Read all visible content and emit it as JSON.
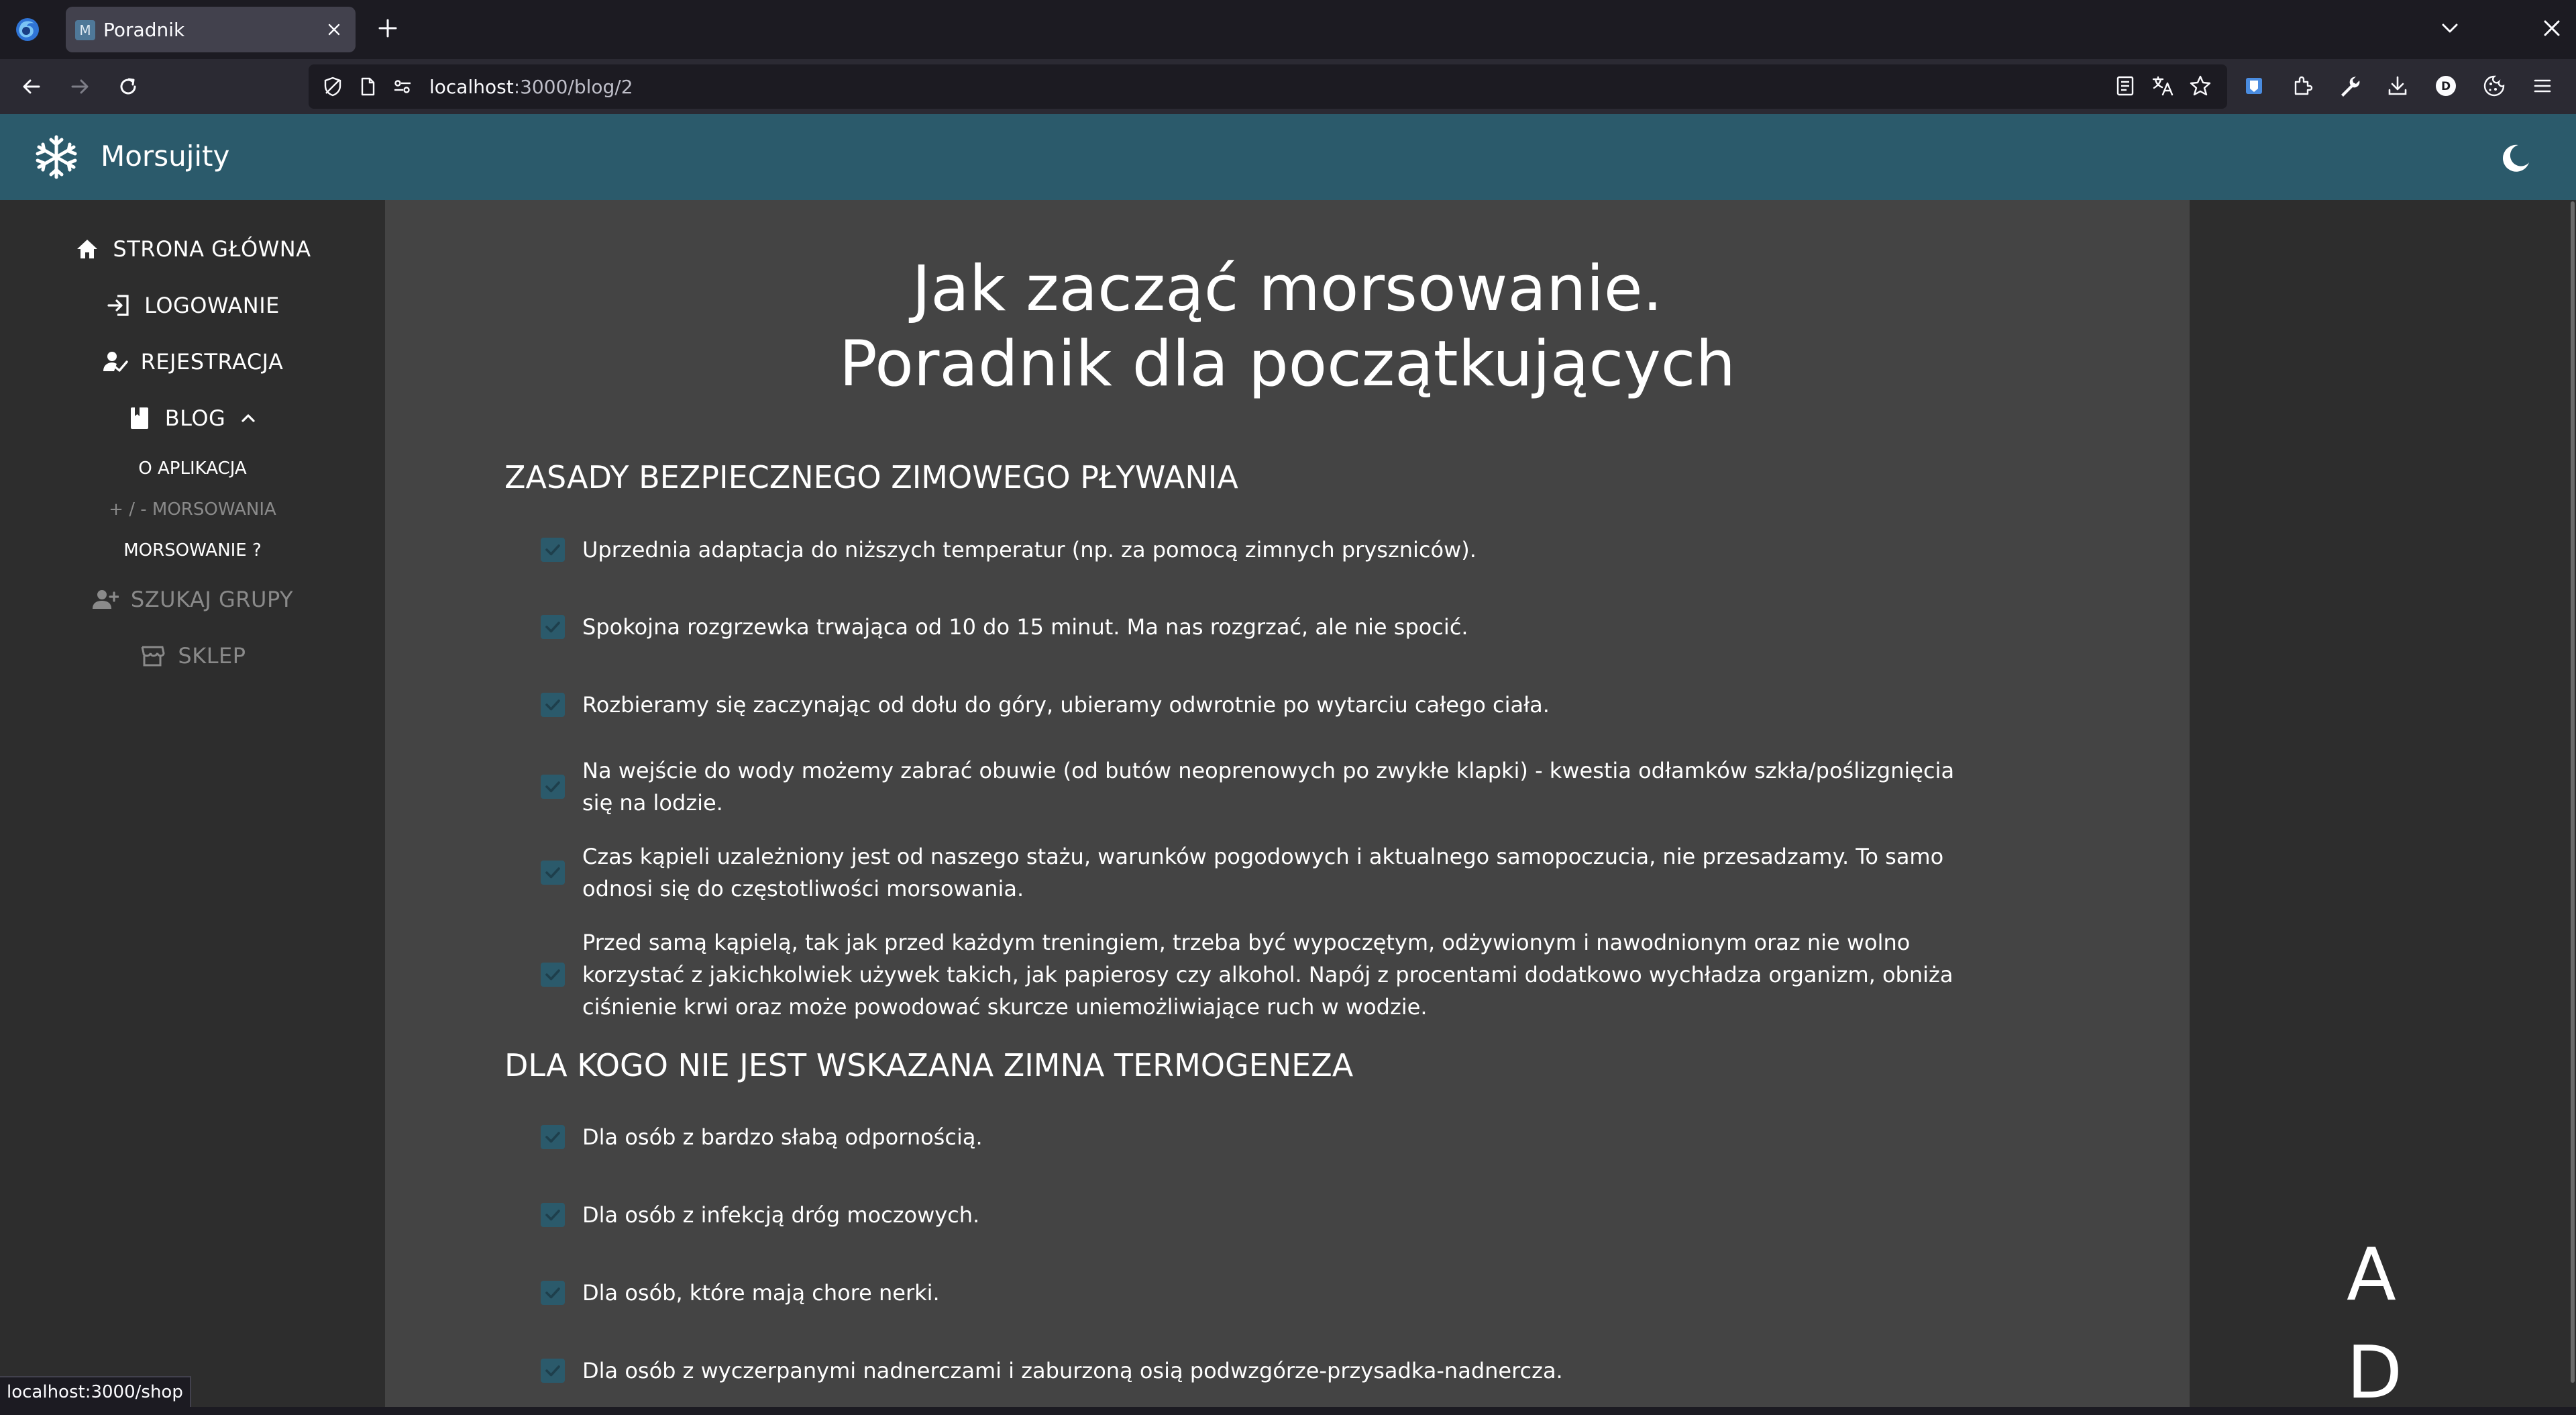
{
  "browser": {
    "tab": {
      "favicon_letter": "M",
      "title": "Poradnik"
    },
    "url": {
      "host": "localhost",
      "path": ":3000/blog/2"
    },
    "status_url": "localhost:3000/shop"
  },
  "app": {
    "title": "Morsujity",
    "brand_color": "#2b5a6b"
  },
  "sidebar": {
    "items": [
      {
        "label": "STRONA GŁÓWNA",
        "icon": "home-icon"
      },
      {
        "label": "LOGOWANIE",
        "icon": "login-icon"
      },
      {
        "label": "REJESTRACJA",
        "icon": "register-icon"
      },
      {
        "label": "BLOG",
        "icon": "book-icon",
        "expanded": true
      },
      {
        "label": "SZUKAJ GRUPY",
        "icon": "group-add-icon",
        "disabled": true
      },
      {
        "label": "SKLEP",
        "icon": "store-icon",
        "disabled": true
      }
    ],
    "blog_sub": [
      {
        "label": "O APLIKACJA",
        "active": false
      },
      {
        "label": "+ / - MORSOWANIA",
        "active": false,
        "dimmed": true
      },
      {
        "label": "MORSOWANIE ?",
        "active": true
      }
    ]
  },
  "article": {
    "title_line1": "Jak zacząć morsowanie.",
    "title_line2": "Poradnik dla początkujących",
    "sections": [
      {
        "heading": "ZASADY BEZPIECZNEGO ZIMOWEGO PŁYWANIA",
        "items": [
          "Uprzednia adaptacja do niższych temperatur (np. za pomocą zimnych pryszniców).",
          "Spokojna rozgrzewka trwająca od 10 do 15 minut. Ma nas rozgrzać, ale nie spocić.",
          "Rozbieramy się zaczynając od dołu do góry, ubieramy odwrotnie po wytarciu całego ciała.",
          "Na wejście do wody możemy zabrać obuwie (od butów neoprenowych po zwykłe klapki) - kwestia odłamków szkła/poślizgnięcia się na lodzie.",
          "Czas kąpieli uzależniony jest od naszego stażu, warunków pogodowych i aktualnego samopoczucia, nie przesadzamy. To samo odnosi się do częstotliwości morsowania.",
          "Przed samą kąpielą, tak jak przed każdym treningiem, trzeba być wypoczętym, odżywionym i nawodnionym oraz nie wolno korzystać z jakichkolwiek używek takich, jak papierosy czy alkohol. Napój z procentami dodatkowo wychładza organizm, obniża ciśnienie krwi oraz może powodować skurcze uniemożliwiające ruch w wodzie."
        ]
      },
      {
        "heading": "DLA KOGO NIE JEST WSKAZANA ZIMNA TERMOGENEZA",
        "items": [
          "Dla osób z bardzo słabą odpornością.",
          "Dla osób z infekcją dróg moczowych.",
          "Dla osób, które mają chore nerki.",
          "Dla osób z wyczerpanymi nadnerczami i zaburzoną osią podwzgórze-przysadka-nadnercza."
        ]
      }
    ]
  },
  "right_gutter": {
    "letters": [
      "A",
      "D"
    ]
  }
}
